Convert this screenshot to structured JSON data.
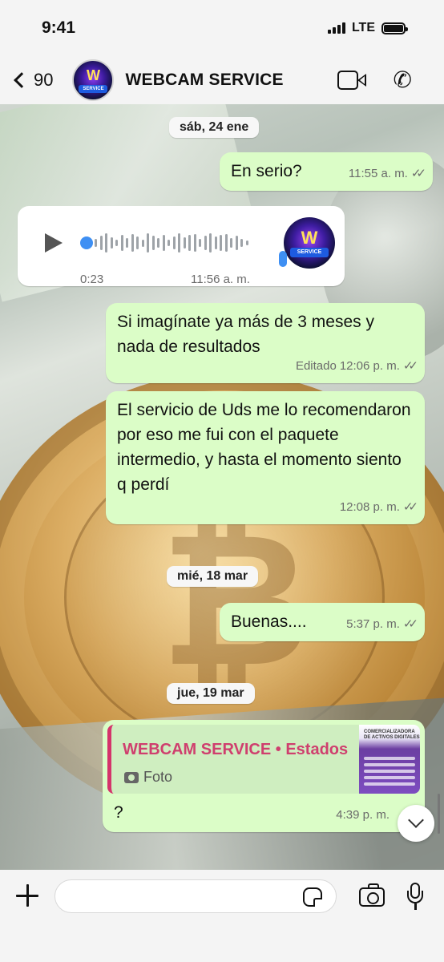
{
  "status_bar": {
    "time": "9:41",
    "network": "LTE"
  },
  "header": {
    "back_count": "90",
    "avatar_letter": "W",
    "avatar_badge": "SERVICE",
    "contact_name": "WEBCAM SERVICE",
    "icons": [
      "chevron-left-icon",
      "video-call-icon",
      "phone-icon"
    ]
  },
  "chat": {
    "date_1": "sáb, 24 ene",
    "msg_1": {
      "text": "En serio?",
      "time": "11:55 a. m.",
      "status": "read"
    },
    "voice": {
      "duration": "0:23",
      "time": "11:56 a. m.",
      "avatar_letter": "W",
      "avatar_badge": "SERVICE"
    },
    "msg_2": {
      "text": "Si imagínate ya más de 3 meses y nada de resultados",
      "edited": "Editado",
      "time": "12:06 p. m.",
      "status": "read"
    },
    "msg_3": {
      "text": "El servicio de Uds me lo recomendaron por eso me fui con el paquete intermedio, y hasta el momento siento q perdí",
      "time": "12:08 p. m.",
      "status": "read"
    },
    "date_2": "mié, 18 mar",
    "msg_4": {
      "text": "Buenas....",
      "time": "5:37 p. m.",
      "status": "read"
    },
    "date_3": "jue, 19 mar",
    "msg_5": {
      "reply_title": "WEBCAM SERVICE • Estados",
      "reply_sub": "Foto",
      "reply_thumb_text": "COMERCIALIZADORA DE ACTIVOS DIGITALES",
      "text": "?",
      "time": "4:39 p. m."
    }
  },
  "composer": {
    "placeholder": ""
  },
  "colors": {
    "outgoing_bubble": "#dbfdc7",
    "incoming_bubble": "#ffffff",
    "reply_accent": "#cf3f6e",
    "voice_accent": "#3e8ff3"
  }
}
